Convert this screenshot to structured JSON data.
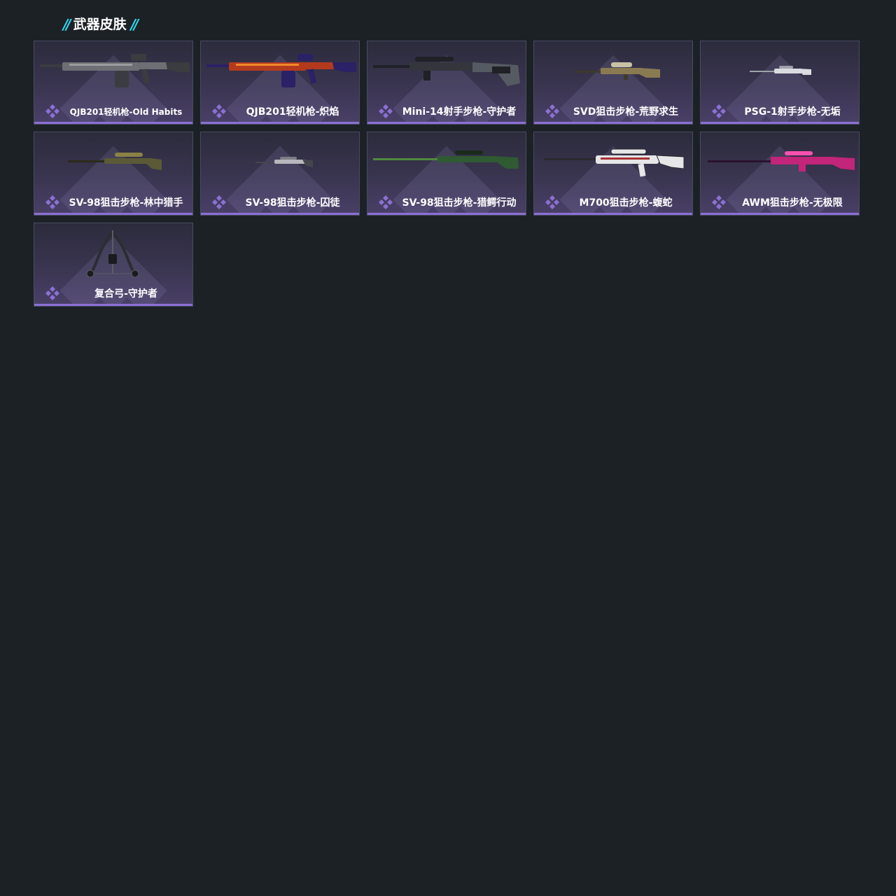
{
  "section": {
    "title": "武器皮肤",
    "accent_color": "#2fd8ee"
  },
  "rarity": {
    "color": "#8b70d4",
    "icon": "diamond-cluster-icon"
  },
  "skins": [
    {
      "label": "QJB201轻机枪-Old Habits",
      "weapon": "lmg",
      "colors": [
        "#6d6f74",
        "#9a9ca0",
        "#3b3c40"
      ]
    },
    {
      "label": "QJB201轻机枪-炽焰",
      "weapon": "lmg",
      "colors": [
        "#b43a1e",
        "#f08a2a",
        "#2b2166"
      ]
    },
    {
      "label": "Mini-14射手步枪-守护者",
      "weapon": "dmr",
      "colors": [
        "#33363d",
        "#565a63",
        "#1f2126"
      ]
    },
    {
      "label": "SVD狙击步枪-荒野求生",
      "weapon": "svd",
      "colors": [
        "#8a7a52",
        "#c9c1a5",
        "#3d3a2b"
      ]
    },
    {
      "label": "PSG-1射手步枪-无垢",
      "weapon": "psg",
      "colors": [
        "#d9dbe0",
        "#9fa2aa",
        "#5c5f66"
      ]
    },
    {
      "label": "SV-98狙击步枪-林中猎手",
      "weapon": "sniper",
      "colors": [
        "#5b5a36",
        "#8a8244",
        "#2c2b1b"
      ]
    },
    {
      "label": "SV-98狙击步枪-囚徒",
      "weapon": "sniper-small",
      "colors": [
        "#b7b7bd",
        "#7d7e85",
        "#45464c"
      ]
    },
    {
      "label": "SV-98狙击步枪-猎鳄行动",
      "weapon": "sniper-long",
      "colors": [
        "#2f5a32",
        "#4f8a3e",
        "#1a2a1a"
      ]
    },
    {
      "label": "M700狙击步枪-蝮蛇",
      "weapon": "m700",
      "colors": [
        "#e6e6e8",
        "#a33",
        "#2a2a2e"
      ]
    },
    {
      "label": "AWM狙击步枪-无极限",
      "weapon": "awm",
      "colors": [
        "#c2257a",
        "#ff4fb0",
        "#2a1230"
      ]
    },
    {
      "label": "复合弓-守护者",
      "weapon": "bow",
      "colors": [
        "#2b2d33",
        "#5a5d66",
        "#1a1b1f"
      ]
    }
  ]
}
